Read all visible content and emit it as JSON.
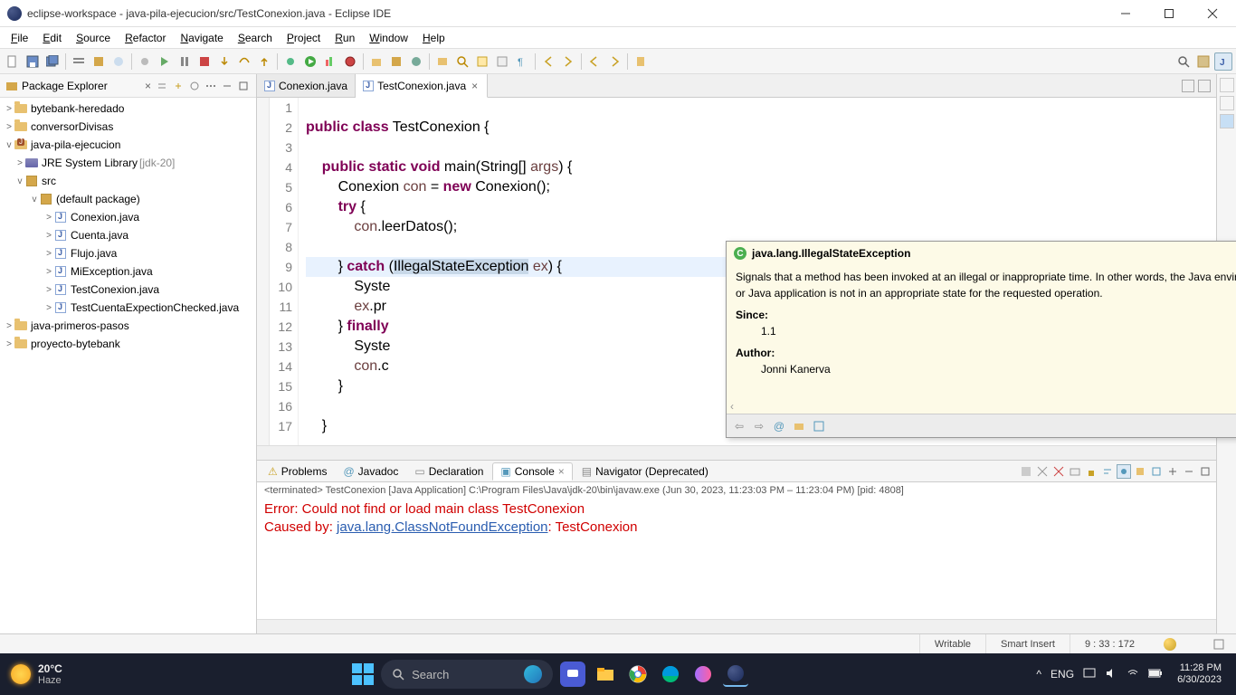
{
  "window": {
    "title": "eclipse-workspace - java-pila-ejecucion/src/TestConexion.java - Eclipse IDE"
  },
  "menu": [
    "File",
    "Edit",
    "Source",
    "Refactor",
    "Navigate",
    "Search",
    "Project",
    "Run",
    "Window",
    "Help"
  ],
  "explorer": {
    "title": "Package Explorer",
    "items": [
      {
        "label": "bytebank-heredado",
        "type": "folder",
        "indent": 0,
        "expand": ">"
      },
      {
        "label": "conversorDivisas",
        "type": "folder",
        "indent": 0,
        "expand": ">"
      },
      {
        "label": "java-pila-ejecucion",
        "type": "project",
        "indent": 0,
        "expand": "v"
      },
      {
        "label": "JRE System Library",
        "suffix": "[jdk-20]",
        "type": "lib",
        "indent": 1,
        "expand": ">"
      },
      {
        "label": "src",
        "type": "pkgroot",
        "indent": 1,
        "expand": "v"
      },
      {
        "label": "(default package)",
        "type": "pkg",
        "indent": 2,
        "expand": "v"
      },
      {
        "label": "Conexion.java",
        "type": "java",
        "indent": 3,
        "expand": ">"
      },
      {
        "label": "Cuenta.java",
        "type": "java",
        "indent": 3,
        "expand": ">"
      },
      {
        "label": "Flujo.java",
        "type": "java",
        "indent": 3,
        "expand": ">"
      },
      {
        "label": "MiException.java",
        "type": "java",
        "indent": 3,
        "expand": ">"
      },
      {
        "label": "TestConexion.java",
        "type": "java",
        "indent": 3,
        "expand": ">"
      },
      {
        "label": "TestCuentaExpectionChecked.java",
        "type": "java",
        "indent": 3,
        "expand": ">"
      },
      {
        "label": "java-primeros-pasos",
        "type": "folder",
        "indent": 0,
        "expand": ">"
      },
      {
        "label": "proyecto-bytebank",
        "type": "folder",
        "indent": 0,
        "expand": ">"
      }
    ]
  },
  "tabs": [
    {
      "label": "Conexion.java",
      "active": false
    },
    {
      "label": "TestConexion.java",
      "active": true
    }
  ],
  "code": {
    "lines": [
      {
        "n": "1",
        "html": ""
      },
      {
        "n": "2",
        "html": "<span class='kw'>public</span> <span class='kw'>class</span> TestConexion {"
      },
      {
        "n": "3",
        "html": ""
      },
      {
        "n": "4",
        "html": "    <span class='kw'>public</span> <span class='kw'>static</span> <span class='kw'>void</span> main(String[] <span class='var'>args</span>) {",
        "fold": true
      },
      {
        "n": "5",
        "html": "        Conexion <span class='var'>con</span> = <span class='kw'>new</span> Conexion();"
      },
      {
        "n": "6",
        "html": "        <span class='kw'>try</span> {"
      },
      {
        "n": "7",
        "html": "            <span class='var'>con</span>.leerDatos();"
      },
      {
        "n": "8",
        "html": ""
      },
      {
        "n": "9",
        "html": "        } <span class='kw'>catch</span> (<span class='sel'>IllegalStateException</span> <span class='var'>ex</span>) {",
        "hl": true
      },
      {
        "n": "10",
        "html": "            Syste"
      },
      {
        "n": "11",
        "html": "            <span class='var'>ex</span>.pr"
      },
      {
        "n": "12",
        "html": "        } <span class='kw'>finally</span>"
      },
      {
        "n": "13",
        "html": "            Syste"
      },
      {
        "n": "14",
        "html": "            <span class='var'>con</span>.c"
      },
      {
        "n": "15",
        "html": "        }"
      },
      {
        "n": "16",
        "html": ""
      },
      {
        "n": "17",
        "html": "    }"
      }
    ]
  },
  "javadoc": {
    "title": "java.lang.IllegalStateException",
    "desc": "Signals that a method has been invoked at an illegal or inappropriate time. In other words, the Java environment or Java application is not in an appropriate state for the requested operation.",
    "since_label": "Since:",
    "since_val": "1.1",
    "author_label": "Author:",
    "author_val": "Jonni Kanerva"
  },
  "bottom": {
    "tabs": [
      {
        "icon": "problem",
        "label": "Problems"
      },
      {
        "icon": "javadoc",
        "label": "Javadoc"
      },
      {
        "icon": "decl",
        "label": "Declaration"
      },
      {
        "icon": "console",
        "label": "Console",
        "active": true
      },
      {
        "icon": "nav",
        "label": "Navigator (Deprecated)"
      }
    ],
    "desc_prefix": "<terminated>",
    "desc_main": " TestConexion [Java Application] C:\\Program Files\\Java\\jdk-20\\bin\\javaw.exe  (Jun 30, 2023, 11:23:03 PM – 11:23:04 PM) [pid: 4808]",
    "line1_pre": "Error: Could not find or load main class TestConexion",
    "line2_pre": "Caused by: ",
    "line2_link": "java.lang.ClassNotFoundException",
    "line2_post": ": TestConexion"
  },
  "status": {
    "writable": "Writable",
    "insert": "Smart Insert",
    "pos": "9 : 33 : 172"
  },
  "taskbar": {
    "weather_temp": "20°C",
    "weather_label": "Haze",
    "search_placeholder": "Search",
    "lang": "ENG",
    "time": "11:28 PM",
    "date": "6/30/2023"
  }
}
